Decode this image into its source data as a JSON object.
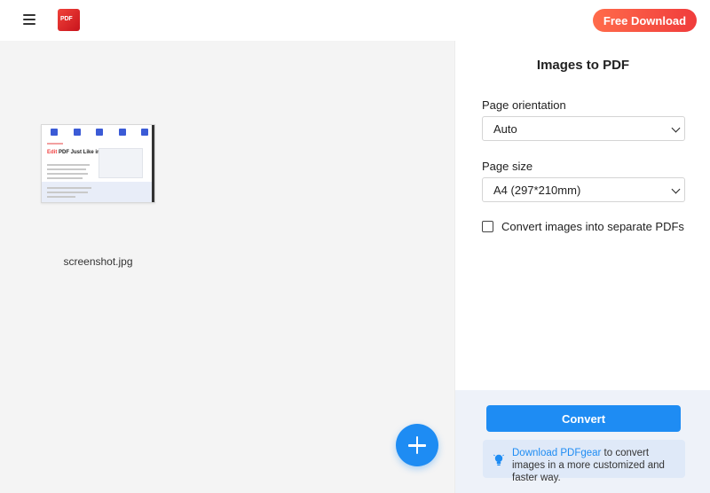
{
  "header": {
    "logo_text": "PDF",
    "free_download_label": "Free Download"
  },
  "left": {
    "thumbnail": {
      "title_accent": "Edit",
      "title_rest": " PDF Just Like in Word"
    },
    "filename": "screenshot.jpg"
  },
  "panel": {
    "title": "Images to PDF",
    "orientation_label": "Page orientation",
    "orientation_value": "Auto",
    "size_label": "Page size",
    "size_value": "A4 (297*210mm)",
    "checkbox_label": "Convert images into separate PDFs"
  },
  "bottom": {
    "convert_label": "Convert",
    "tip_link": "Download PDFgear",
    "tip_text": " to convert images in a more customized and faster way."
  },
  "colors": {
    "accent": "#1e8cf3",
    "brand_red": "#f0423a"
  }
}
